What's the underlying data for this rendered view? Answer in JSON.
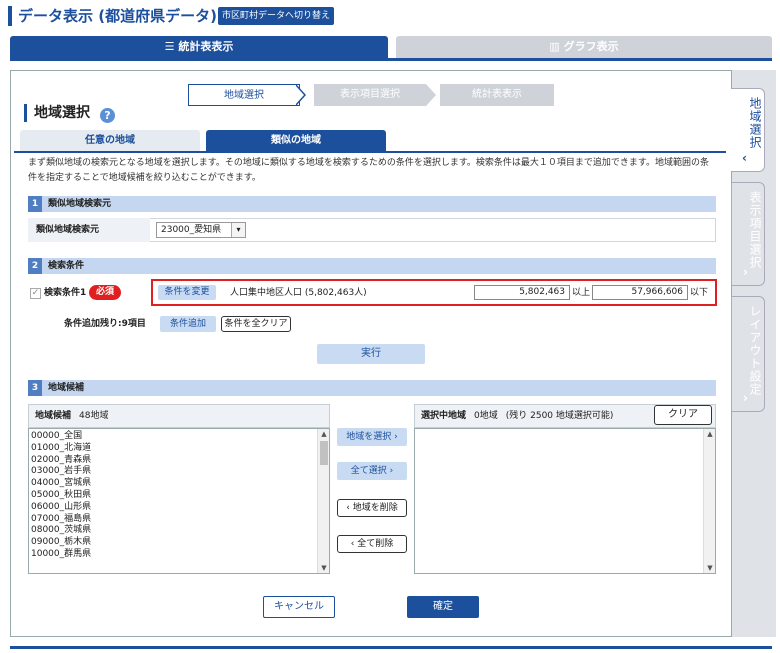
{
  "header": {
    "title": "データ表示 (都道府県データ)",
    "switch_label": "市区町村データへ切り替え"
  },
  "main_tabs": {
    "table_label": "統計表表示",
    "graph_label": "グラフ表示"
  },
  "steps": [
    "地域選択",
    "表示項目選択",
    "統計表表示"
  ],
  "side_tabs": {
    "region": "地域選択",
    "items": "表示項目選択",
    "layout": "レイアウト設定"
  },
  "section": {
    "title": "地域選択",
    "help": "?"
  },
  "sub_tabs": {
    "any_label": "任意の地域",
    "similar_label": "類似の地域"
  },
  "description": "まず類似地域の検索元となる地域を選択します。その地域に類似する地域を検索するための条件を選択します。検索条件は最大１０項目まで追加できます。地域範囲の条件を指定することで地域候補を絞り込むことができます。",
  "sec1": {
    "num": "1",
    "title": "類似地域検索元",
    "label": "類似地域検索元",
    "select_value": "23000_愛知県"
  },
  "sec2": {
    "num": "2",
    "title": "検索条件",
    "cond_label": "検索条件1",
    "required": "必須",
    "change_btn": "条件を変更",
    "cond_text": "人口集中地区人口 (5,802,463人)",
    "min_value": "5,802,463",
    "min_unit": "以上",
    "max_value": "57,966,606",
    "max_unit": "以下",
    "remain": "条件追加残り:9項目",
    "add_btn": "条件追加",
    "clear_all_btn": "条件を全クリア",
    "exec_btn": "実行"
  },
  "sec3": {
    "num": "3",
    "title": "地域候補",
    "left_title": "地域候補",
    "left_count": "48地域",
    "items": [
      "00000_全国",
      "01000_北海道",
      "02000_青森県",
      "03000_岩手県",
      "04000_宮城県",
      "05000_秋田県",
      "06000_山形県",
      "07000_福島県",
      "08000_茨城県",
      "09000_栃木県",
      "10000_群馬県"
    ],
    "select_btn": "地域を選択",
    "select_all_btn": "全て選択",
    "delete_btn": "地域を削除",
    "delete_all_btn": "全て削除",
    "right_title": "選択中地域",
    "right_count": "0地域",
    "right_note": "(残り 2500 地域選択可能)",
    "clear_btn": "クリア"
  },
  "footer": {
    "cancel": "キャンセル",
    "ok": "確定"
  },
  "colors": {
    "primary": "#1c4f9c",
    "highlight": "#e02020",
    "light_blue": "#c9dbf3"
  }
}
